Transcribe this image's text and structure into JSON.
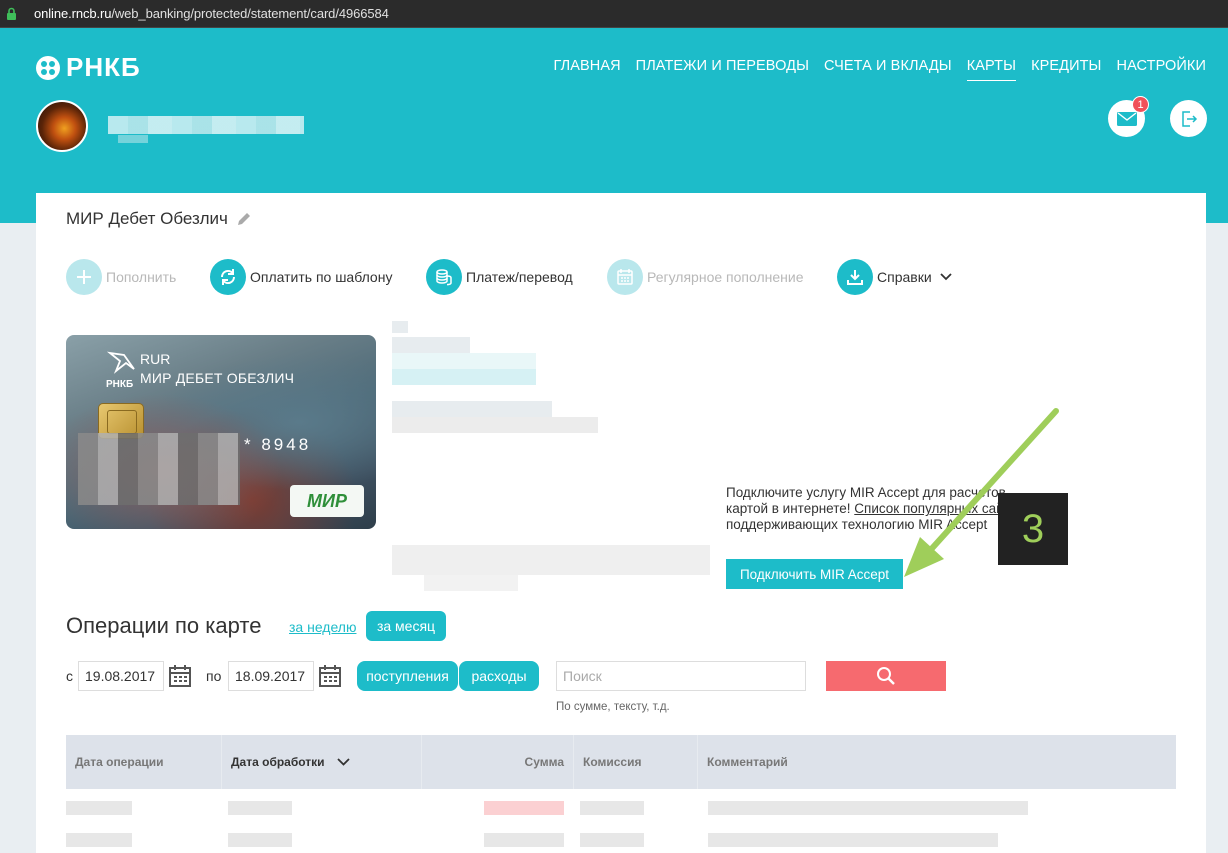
{
  "browser": {
    "url_host": "online.rncb.ru",
    "url_path": "/web_banking/protected/statement/card/4966584"
  },
  "brand": {
    "name": "РНКБ",
    "accent": "#1dbcc9",
    "danger": "#f66a6f"
  },
  "nav": [
    {
      "label": "ГЛАВНАЯ",
      "active": false
    },
    {
      "label": "ПЛАТЕЖИ И ПЕРЕВОДЫ",
      "active": false
    },
    {
      "label": "СЧЕТА И ВКЛАДЫ",
      "active": false
    },
    {
      "label": "КАРТЫ",
      "active": true
    },
    {
      "label": "КРЕДИТЫ",
      "active": false
    },
    {
      "label": "НАСТРОЙКИ",
      "active": false
    }
  ],
  "header": {
    "mail_badge": "1"
  },
  "card": {
    "title": "МИР Дебет Обезлич",
    "currency": "RUR",
    "name": "МИР ДЕБЕТ ОБЕЗЛИЧ",
    "number_masked": "* 8948",
    "network": "МИР",
    "logo_text": "РНКБ"
  },
  "actions": [
    {
      "label": "Пополнить",
      "icon": "plus-icon",
      "enabled": false
    },
    {
      "label": "Оплатить по шаблону",
      "icon": "refresh-icon",
      "enabled": true
    },
    {
      "label": "Платеж/перевод",
      "icon": "coins-icon",
      "enabled": true
    },
    {
      "label": "Регулярное пополнение",
      "icon": "calendar-icon",
      "enabled": false
    },
    {
      "label": "Справки",
      "icon": "download-icon",
      "enabled": true
    }
  ],
  "mir_accept": {
    "text_before": "Подключите услугу MIR Accept для расчетов картой в интернете! ",
    "link_text": "Список популярных сайтов ",
    "text_after": "поддерживающих технологию MIR Accept",
    "button_label": "Подключить MIR Accept"
  },
  "annotation": {
    "step": "3"
  },
  "operations": {
    "title": "Операции по карте",
    "period_week": "за неделю",
    "period_month": "за месяц",
    "from_label": "с",
    "from_date": "19.08.2017",
    "to_label": "по",
    "to_date": "18.09.2017",
    "filter_income": "поступления",
    "filter_expense": "расходы",
    "search_placeholder": "Поиск",
    "search_hint": "По сумме, тексту, т.д."
  },
  "table": {
    "columns": [
      "Дата операции",
      "Дата обработки",
      "Сумма",
      "Комиссия",
      "Комментарий"
    ]
  }
}
